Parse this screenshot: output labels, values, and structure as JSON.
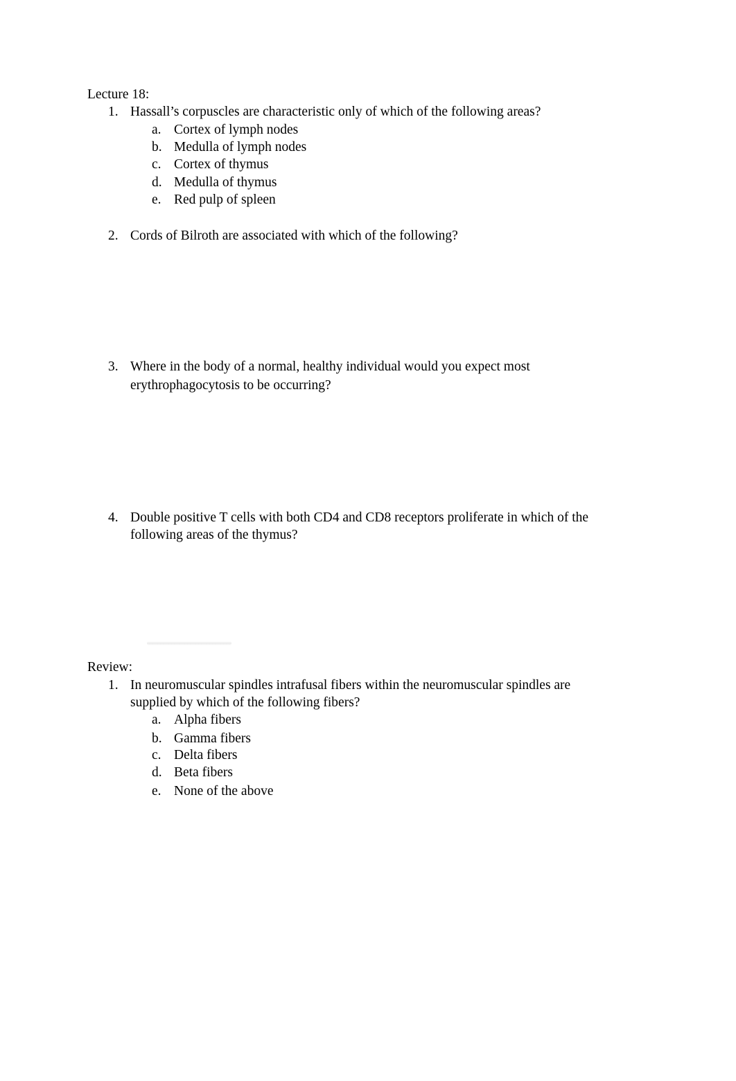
{
  "sections": [
    {
      "heading": "Lecture 18:",
      "questions": [
        {
          "number": "1.",
          "lines": [
            "Hassall’s corpuscles are characteristic only of which of the following areas?"
          ],
          "options": [
            {
              "letter": "a.",
              "text": "Cortex of lymph nodes"
            },
            {
              "letter": "b.",
              "text": "Medulla of lymph nodes"
            },
            {
              "letter": "c.",
              "text": "Cortex of thymus"
            },
            {
              "letter": "d.",
              "text": "Medulla of thymus"
            },
            {
              "letter": "e.",
              "text": "Red pulp of spleen"
            }
          ]
        },
        {
          "number": "2.",
          "lines": [
            "Cords of Bilroth are associated with which of the following?"
          ],
          "options": []
        },
        {
          "number": "3.",
          "lines": [
            "Where in the body of a normal, healthy individual would you expect most",
            "erythrophagocytosis to be occurring?"
          ],
          "options": []
        },
        {
          "number": "4.",
          "lines": [
            "Double positive T cells with both CD4 and CD8 receptors proliferate in which of the",
            "following areas of the thymus?"
          ],
          "options": []
        }
      ]
    },
    {
      "heading": "Review:",
      "questions": [
        {
          "number": "1.",
          "lines": [
            "In neuromuscular spindles intrafusal fibers within the neuromuscular spindles are",
            "supplied by which of the following fibers?"
          ],
          "options": [
            {
              "letter": "a.",
              "text": "Alpha fibers"
            },
            {
              "letter": "b.",
              "text": "Gamma fibers"
            },
            {
              "letter": "c.",
              "text": "Delta fibers"
            },
            {
              "letter": "d.",
              "text": "Beta fibers"
            },
            {
              "letter": "e.",
              "text": "None of the above"
            }
          ]
        }
      ]
    }
  ]
}
